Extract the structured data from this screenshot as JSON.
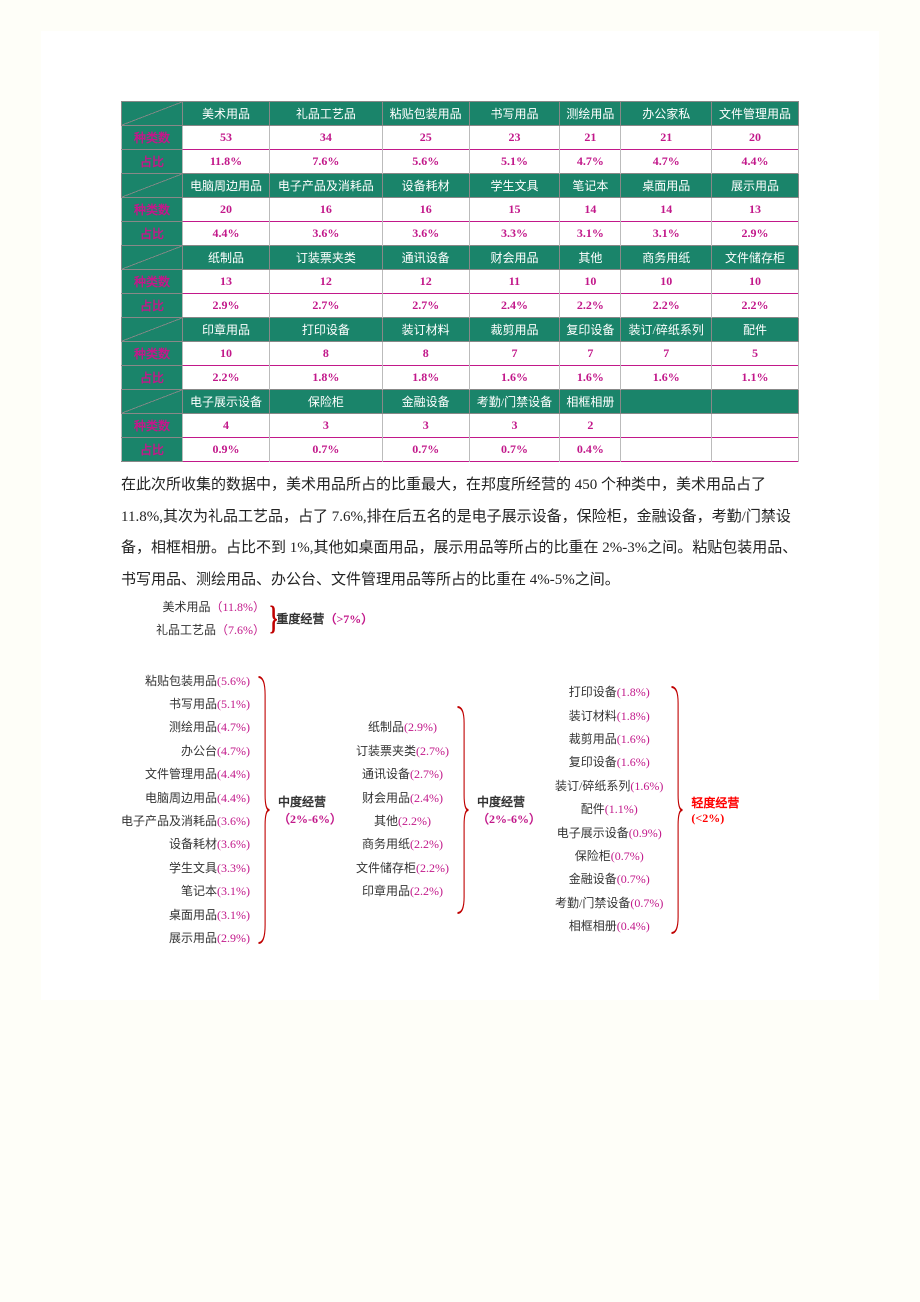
{
  "labels": {
    "count": "种类数",
    "ratio": "占比",
    "heavyLabel": "重度经营",
    "heavyRange": "（>7%）",
    "midLabel": "中度经营",
    "midRange": "（2%-6%）",
    "lightLabel": "轻度经营",
    "lightRange": "(<2%)"
  },
  "rows": [
    {
      "cats": [
        "美术用品",
        "礼品工艺品",
        "粘贴包装用品",
        "书写用品",
        "测绘用品",
        "办公家私",
        "文件管理用品"
      ],
      "counts": [
        "53",
        "34",
        "25",
        "23",
        "21",
        "21",
        "20"
      ],
      "ratios": [
        "11.8%",
        "7.6%",
        "5.6%",
        "5.1%",
        "4.7%",
        "4.7%",
        "4.4%"
      ]
    },
    {
      "cats": [
        "电脑周边用品",
        "电子产品及消耗品",
        "设备耗材",
        "学生文具",
        "笔记本",
        "桌面用品",
        "展示用品"
      ],
      "counts": [
        "20",
        "16",
        "16",
        "15",
        "14",
        "14",
        "13"
      ],
      "ratios": [
        "4.4%",
        "3.6%",
        "3.6%",
        "3.3%",
        "3.1%",
        "3.1%",
        "2.9%"
      ]
    },
    {
      "cats": [
        "纸制品",
        "订装票夹类",
        "通讯设备",
        "财会用品",
        "其他",
        "商务用纸",
        "文件储存柜"
      ],
      "counts": [
        "13",
        "12",
        "12",
        "11",
        "10",
        "10",
        "10"
      ],
      "ratios": [
        "2.9%",
        "2.7%",
        "2.7%",
        "2.4%",
        "2.2%",
        "2.2%",
        "2.2%"
      ]
    },
    {
      "cats": [
        "印章用品",
        "打印设备",
        "装订材料",
        "裁剪用品",
        "复印设备",
        "装订/碎纸系列",
        "配件"
      ],
      "counts": [
        "10",
        "8",
        "8",
        "7",
        "7",
        "7",
        "5"
      ],
      "ratios": [
        "2.2%",
        "1.8%",
        "1.8%",
        "1.6%",
        "1.6%",
        "1.6%",
        "1.1%"
      ]
    },
    {
      "cats": [
        "电子展示设备",
        "保险柜",
        "金融设备",
        "考勤/门禁设备",
        "相框相册",
        "",
        ""
      ],
      "counts": [
        "4",
        "3",
        "3",
        "3",
        "2",
        "",
        ""
      ],
      "ratios": [
        "0.9%",
        "0.7%",
        "0.7%",
        "0.7%",
        "0.4%",
        "",
        ""
      ]
    }
  ],
  "paragraph": "在此次所收集的数据中，美术用品所占的比重最大，在邦度所经营的 450 个种类中，美术用品占了 11.8%,其次为礼品工艺品，占了 7.6%,排在后五名的是电子展示设备，保险柜，金融设备，考勤/门禁设备，相框相册。占比不到 1%,其他如桌面用品，展示用品等所占的比重在 2%-3%之间。粘贴包装用品、书写用品、测绘用品、办公台、文件管理用品等所占的比重在 4%-5%之间。",
  "heavy": [
    {
      "name": "美术用品",
      "pct": "（11.8%）"
    },
    {
      "name": "礼品工艺品",
      "pct": "（7.6%）"
    }
  ],
  "midA": [
    {
      "name": "粘贴包装用品",
      "pct": "(5.6%)"
    },
    {
      "name": "书写用品",
      "pct": "(5.1%)"
    },
    {
      "name": "测绘用品",
      "pct": "(4.7%)"
    },
    {
      "name": "办公台",
      "pct": "(4.7%)"
    },
    {
      "name": "文件管理用品",
      "pct": "(4.4%)"
    },
    {
      "name": "电脑周边用品",
      "pct": "(4.4%)"
    },
    {
      "name": "电子产品及消耗品",
      "pct": "(3.6%)"
    },
    {
      "name": "设备耗材",
      "pct": "(3.6%)"
    },
    {
      "name": "学生文具",
      "pct": "(3.3%)"
    },
    {
      "name": "笔记本",
      "pct": "(3.1%)"
    },
    {
      "name": "桌面用品",
      "pct": "(3.1%)"
    },
    {
      "name": "展示用品",
      "pct": "(2.9%)"
    }
  ],
  "midB": [
    {
      "name": "纸制品",
      "pct": "(2.9%)"
    },
    {
      "name": "订装票夹类",
      "pct": "(2.7%)"
    },
    {
      "name": "通讯设备",
      "pct": "(2.7%)"
    },
    {
      "name": "财会用品",
      "pct": "(2.4%)"
    },
    {
      "name": "其他",
      "pct": "(2.2%)"
    },
    {
      "name": "商务用纸",
      "pct": "(2.2%)"
    },
    {
      "name": "文件储存柜",
      "pct": "(2.2%)"
    },
    {
      "name": "印章用品",
      "pct": "(2.2%)"
    }
  ],
  "light": [
    {
      "name": "打印设备",
      "pct": "(1.8%)"
    },
    {
      "name": "装订材料",
      "pct": "(1.8%)"
    },
    {
      "name": "裁剪用品",
      "pct": "(1.6%)"
    },
    {
      "name": "复印设备",
      "pct": "(1.6%)"
    },
    {
      "name": "装订/碎纸系列",
      "pct": "(1.6%)"
    },
    {
      "name": "配件",
      "pct": "(1.1%)"
    },
    {
      "name": "电子展示设备",
      "pct": "(0.9%)"
    },
    {
      "name": "保险柜",
      "pct": "(0.7%)"
    },
    {
      "name": "金融设备",
      "pct": "(0.7%)"
    },
    {
      "name": "考勤/门禁设备",
      "pct": "(0.7%)"
    },
    {
      "name": "相框相册",
      "pct": "(0.4%)"
    }
  ]
}
